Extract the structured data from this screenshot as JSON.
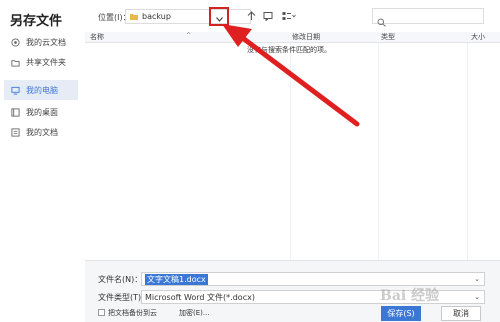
{
  "dialog": {
    "title": "另存文件"
  },
  "sidebar": {
    "items": [
      {
        "label": "我的云文档",
        "icon": "cloud-doc-icon",
        "active": false
      },
      {
        "label": "共享文件夹",
        "icon": "share-folder-icon",
        "active": false
      },
      {
        "label": "我的电脑",
        "icon": "computer-icon",
        "active": true
      },
      {
        "label": "我的桌面",
        "icon": "desktop-icon",
        "active": false
      },
      {
        "label": "我的文档",
        "icon": "documents-icon",
        "active": false
      }
    ]
  },
  "toolbar": {
    "location_label": "位置(I)：",
    "location_value": "backup",
    "search_placeholder": ""
  },
  "filelist": {
    "columns": [
      "名称",
      "修改日期",
      "类型",
      "大小"
    ],
    "empty_message": "没有与搜索条件匹配的项。"
  },
  "bottom": {
    "filename_label": "文件名(N)：",
    "filename_value": "文字文稿1.docx",
    "filetype_label": "文件类型(T)：",
    "filetype_value": "Microsoft Word 文件(*.docx)",
    "backup_checkbox_label": "把文档备份到云",
    "encrypt_label": "加密(E)...",
    "save_label": "保存(S)",
    "cancel_label": "取消"
  },
  "colors": {
    "highlight_border": "#d32424",
    "arrow": "#e02020",
    "accent": "#3b78d6"
  },
  "watermark": "Bai 经验"
}
